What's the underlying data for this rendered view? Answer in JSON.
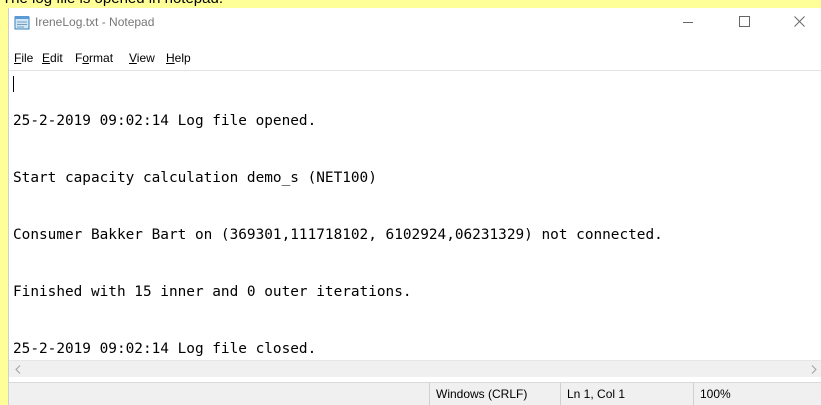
{
  "caption": "The log file is opened in notepad.",
  "window": {
    "title": "IreneLog.txt - Notepad",
    "icons": {
      "app": "notepad-icon",
      "minimize": "minimize-icon",
      "maximize": "maximize-icon",
      "close": "close-icon"
    }
  },
  "menu": {
    "file": {
      "mnemonic": "F",
      "rest": "ile"
    },
    "edit": {
      "mnemonic": "E",
      "rest": "dit"
    },
    "format": {
      "pre": "F",
      "mnemonic": "o",
      "rest": "rmat"
    },
    "view": {
      "mnemonic": "V",
      "rest": "iew"
    },
    "help": {
      "mnemonic": "H",
      "rest": "elp"
    }
  },
  "editor": {
    "lines": [
      "25-2-2019 09:02:14 Log file opened.",
      "Start capacity calculation demo_s (NET100)",
      "Consumer Bakker Bart on (369301,111718102, 6102924,06231329) not connected.",
      "Finished with 15 inner and 0 outer iterations.",
      "25-2-2019 09:02:14 Log file closed."
    ]
  },
  "scrollbar": {
    "left_arrow": "<",
    "right_arrow": ">"
  },
  "status": {
    "line_ending": "Windows (CRLF)",
    "position": "Ln 1, Col 1",
    "zoom": "100%"
  }
}
